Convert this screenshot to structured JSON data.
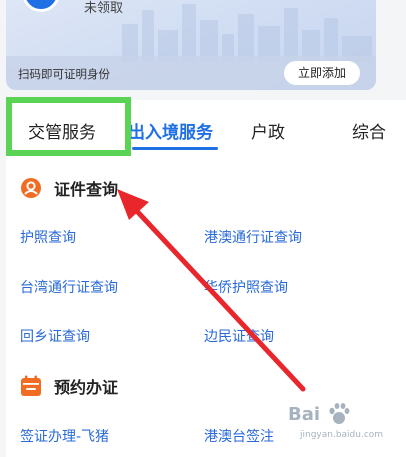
{
  "id_card": {
    "status": "未领取",
    "hint": "扫码即可证明身份",
    "add_button": "立即添加"
  },
  "tabs": [
    {
      "label": "交管服务",
      "active": false,
      "highlighted": true
    },
    {
      "label": "出入境服务",
      "active": true
    },
    {
      "label": "户政",
      "active": false
    },
    {
      "label": "综合",
      "active": false
    }
  ],
  "sections": [
    {
      "title": "证件查询",
      "icon": "id-search-icon",
      "items": [
        "护照查询",
        "港澳通行证查询",
        "台湾通行证查询",
        "华侨护照查询",
        "回乡证查询",
        "边民证查询"
      ]
    },
    {
      "title": "预约办证",
      "icon": "calendar-icon",
      "items": [
        "签证办理-飞猪",
        "港澳台签注"
      ]
    }
  ],
  "watermark": {
    "main": "Bai",
    "sub": "jingyan.baidu.com"
  },
  "colors": {
    "accent": "#1f6fe5",
    "link": "#2a6ad8",
    "icon_orange": "#f26b22",
    "highlight_green": "#5bd455",
    "annotation_red": "#e8262c"
  }
}
